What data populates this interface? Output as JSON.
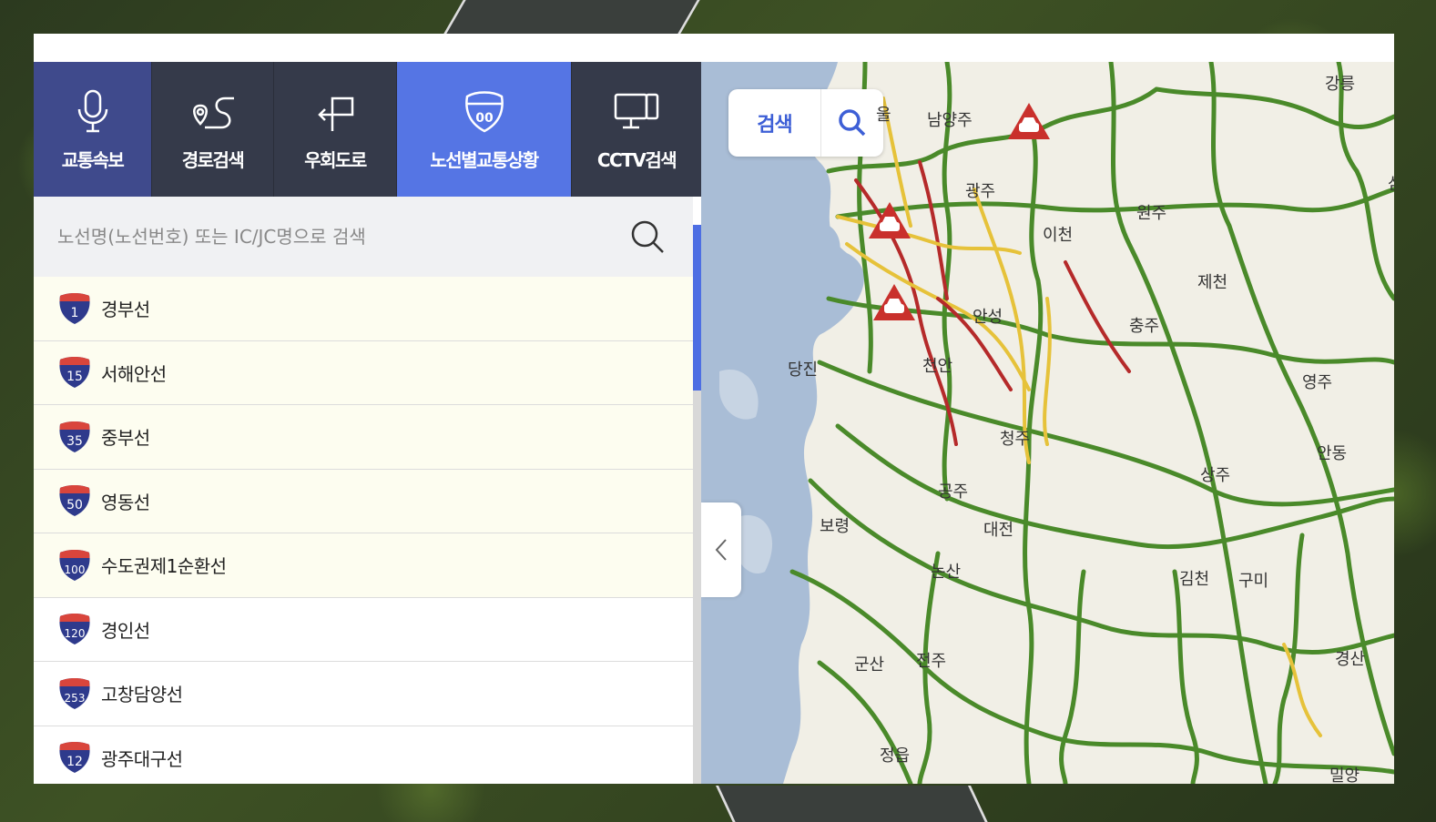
{
  "tabs": [
    {
      "label": "교통속보",
      "icon": "microphone-icon"
    },
    {
      "label": "경로검색",
      "icon": "route-icon"
    },
    {
      "label": "우회도로",
      "icon": "detour-icon"
    },
    {
      "label": "노선별교통상황",
      "icon": "route-shield-icon"
    },
    {
      "label": "CCTV검색",
      "icon": "monitor-icon"
    }
  ],
  "active_tab": "노선별교통상황",
  "search": {
    "placeholder": "노선명(노선번호) 또는 IC/JC명으로 검색"
  },
  "routes": [
    {
      "number": "1",
      "name": "경부선"
    },
    {
      "number": "15",
      "name": "서해안선"
    },
    {
      "number": "35",
      "name": "중부선"
    },
    {
      "number": "50",
      "name": "영동선"
    },
    {
      "number": "100",
      "name": "수도권제1순환선"
    },
    {
      "number": "120",
      "name": "경인선"
    },
    {
      "number": "253",
      "name": "고창담양선"
    },
    {
      "number": "12",
      "name": "광주대구선"
    }
  ],
  "map": {
    "search_label": "검색",
    "cities": [
      "강릉",
      "울",
      "남양주",
      "광주",
      "원주",
      "이천",
      "제천",
      "안성",
      "충주",
      "당진",
      "천안",
      "영주",
      "청주",
      "안동",
      "상주",
      "공주",
      "보령",
      "대전",
      "논산",
      "김천",
      "구미",
      "군산",
      "전주",
      "정읍",
      "밀양",
      "경산",
      "삼"
    ]
  },
  "colors": {
    "accent": "#5575e4",
    "tab_dark": "#353a4a",
    "tab_first": "#3f4a8c",
    "shield_blue": "#2e3a8c",
    "shield_red": "#d9453c",
    "road_green": "#4a8a2a",
    "jam_red": "#b52a2a",
    "slow_yellow": "#e6c23a"
  }
}
